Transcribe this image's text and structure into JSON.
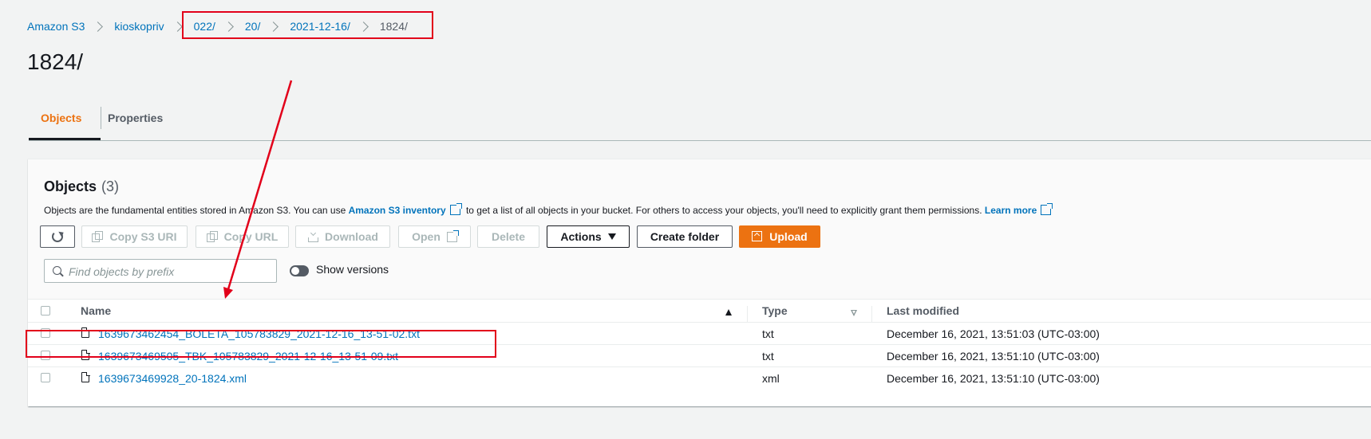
{
  "breadcrumb": [
    {
      "label": "Amazon S3",
      "current": false
    },
    {
      "label": "kioskopriv",
      "current": false
    },
    {
      "label": "022/",
      "current": false
    },
    {
      "label": "20/",
      "current": false
    },
    {
      "label": "2021-12-16/",
      "current": false
    },
    {
      "label": "1824/",
      "current": true
    }
  ],
  "page_title": "1824/",
  "tabs": [
    {
      "label": "Objects",
      "active": true
    },
    {
      "label": "Properties",
      "active": false
    }
  ],
  "objects_panel": {
    "title": "Objects",
    "count": "(3)",
    "description": {
      "before": "Objects are the fundamental entities stored in Amazon S3. You can use",
      "inventory_link": "Amazon S3 inventory",
      "middle": "to get a list of all objects in your bucket. For others to access your objects, you'll need to explicitly grant them permissions.",
      "learn_more": "Learn more"
    },
    "toolbar": {
      "refresh_icon": "refresh-icon",
      "copy_s3_uri": "Copy S3 URI",
      "copy_url": "Copy URL",
      "download": "Download",
      "open": "Open",
      "delete": "Delete",
      "actions": "Actions",
      "create_folder": "Create folder",
      "upload": "Upload"
    },
    "search": {
      "placeholder": "Find objects by prefix",
      "value": ""
    },
    "show_versions": {
      "label": "Show versions",
      "on": false
    },
    "columns": {
      "name": "Name",
      "type": "Type",
      "last_modified": "Last modified"
    },
    "rows": [
      {
        "name": "1639673462454_BOLETA_105783829_2021-12-16_13-51-02.txt",
        "type": "txt",
        "last_modified": "December 16, 2021, 13:51:03 (UTC-03:00)"
      },
      {
        "name": "1639673469505_TBK_105783829_2021-12-16_13-51-09.txt",
        "type": "txt",
        "last_modified": "December 16, 2021, 13:51:10 (UTC-03:00)"
      },
      {
        "name": "1639673469928_20-1824.xml",
        "type": "xml",
        "last_modified": "December 16, 2021, 13:51:10 (UTC-03:00)"
      }
    ]
  },
  "colors": {
    "accent": "#ec7211",
    "link": "#0073bb",
    "annotation": "#e2001a"
  }
}
